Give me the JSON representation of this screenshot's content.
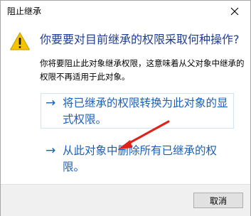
{
  "window": {
    "title": "阻止继承"
  },
  "icons": {
    "close": "close-icon",
    "warning": "warning-icon",
    "command_arrow": "arrow-right-icon"
  },
  "colors": {
    "link": "#1b5fb8",
    "question": "#1f3d99",
    "warning_fill": "#f4c400",
    "annotation": "#e0201a"
  },
  "dialog": {
    "question": "你要要对目前继承的权限采取何种操作?",
    "description": "你将要阻止此对象继承权限，这意味着从父对象中继承的权限不再适用于此对象。",
    "commands": [
      {
        "arrow": "→",
        "label": "将已继承的权限转换为此对象的显式权限。"
      },
      {
        "arrow": "→",
        "label": "从此对象中删除所有已继承的权限。"
      }
    ]
  },
  "footer": {
    "cancel_label": "取消"
  }
}
